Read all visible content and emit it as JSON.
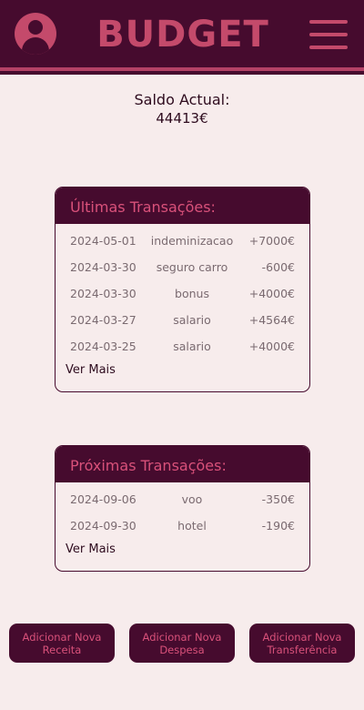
{
  "header": {
    "title": "BUDGET",
    "avatar_icon": "user-icon",
    "menu_icon": "hamburger-menu-icon",
    "colors": {
      "bar": "#460b2e",
      "accent": "#c44a6b"
    }
  },
  "balance": {
    "label": "Saldo Actual:",
    "value": "44413€"
  },
  "recent": {
    "title": "Últimas Transações:",
    "rows": [
      {
        "date": "2024-05-01",
        "description": "indeminizacao",
        "amount": "+7000€"
      },
      {
        "date": "2024-03-30",
        "description": "seguro carro",
        "amount": "-600€"
      },
      {
        "date": "2024-03-30",
        "description": "bonus",
        "amount": "+4000€"
      },
      {
        "date": "2024-03-27",
        "description": "salario",
        "amount": "+4564€"
      },
      {
        "date": "2024-03-25",
        "description": "salario",
        "amount": "+4000€"
      }
    ],
    "more_label": "Ver Mais"
  },
  "upcoming": {
    "title": "Próximas Transações:",
    "rows": [
      {
        "date": "2024-09-06",
        "description": "voo",
        "amount": "-350€"
      },
      {
        "date": "2024-09-30",
        "description": "hotel",
        "amount": "-190€"
      }
    ],
    "more_label": "Ver Mais"
  },
  "actions": {
    "add_income": "Adicionar Nova Receita",
    "add_expense": "Adicionar Nova Despesa",
    "add_transfer": "Adicionar Nova Transferência"
  }
}
